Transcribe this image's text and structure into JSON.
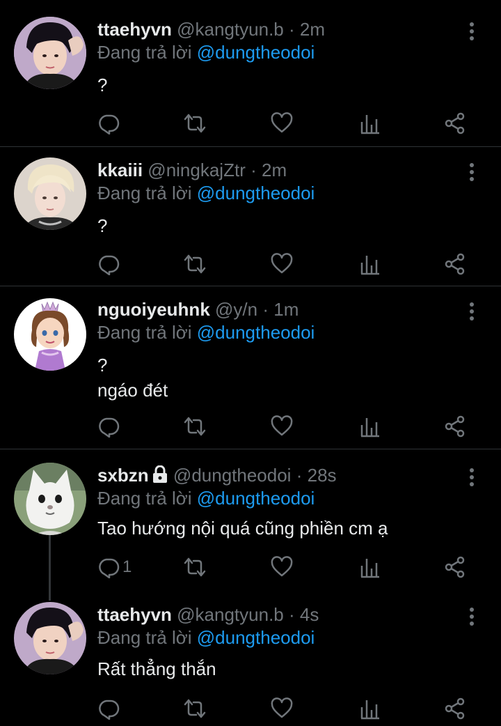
{
  "colors": {
    "background": "#000000",
    "text": "#e7e9ea",
    "muted": "#71767b",
    "accent": "#1d9bf0",
    "divider": "#2f3336"
  },
  "tweets": [
    {
      "name": "ttaehyvn",
      "handle": "@kangtyun.b",
      "sep": "·",
      "time": "2m",
      "reply_prefix": "Đang trả lời ",
      "reply_to": "@dungtheodoi",
      "text": "?",
      "reply_count": "",
      "avatar": "boy-avatar"
    },
    {
      "name": "kkaiii",
      "handle": "@ningkajZtr",
      "sep": "·",
      "time": "2m",
      "reply_prefix": "Đang trả lời ",
      "reply_to": "@dungtheodoi",
      "text": "?",
      "reply_count": "",
      "avatar": "blond-avatar"
    },
    {
      "name": "nguoiyeuhnk",
      "handle": "@y/n",
      "sep": "·",
      "time": "1m",
      "reply_prefix": "Đang trả lời ",
      "reply_to": "@dungtheodoi",
      "text": "?\nngáo đét",
      "reply_count": "",
      "avatar": "princess-avatar"
    },
    {
      "name": "sxbzn",
      "handle": "@dungtheodoi",
      "sep": "·",
      "time": "28s",
      "reply_prefix": "Đang trả lời ",
      "reply_to": "@dungtheodoi",
      "text": "Tao hướng nội quá cũng phiền cm ạ",
      "reply_count": "1",
      "avatar": "cat-avatar",
      "locked": true
    },
    {
      "name": "ttaehyvn",
      "handle": "@kangtyun.b",
      "sep": "·",
      "time": "4s",
      "reply_prefix": "Đang trả lời ",
      "reply_to": "@dungtheodoi",
      "text": "Rất thẳng thắn",
      "reply_count": "",
      "avatar": "boy-avatar"
    }
  ],
  "icons": {
    "reply": "reply-icon",
    "retweet": "retweet-icon",
    "like": "heart-icon",
    "analytics": "analytics-icon",
    "share": "share-icon",
    "more": "more-vertical-icon",
    "lock": "lock-icon"
  }
}
